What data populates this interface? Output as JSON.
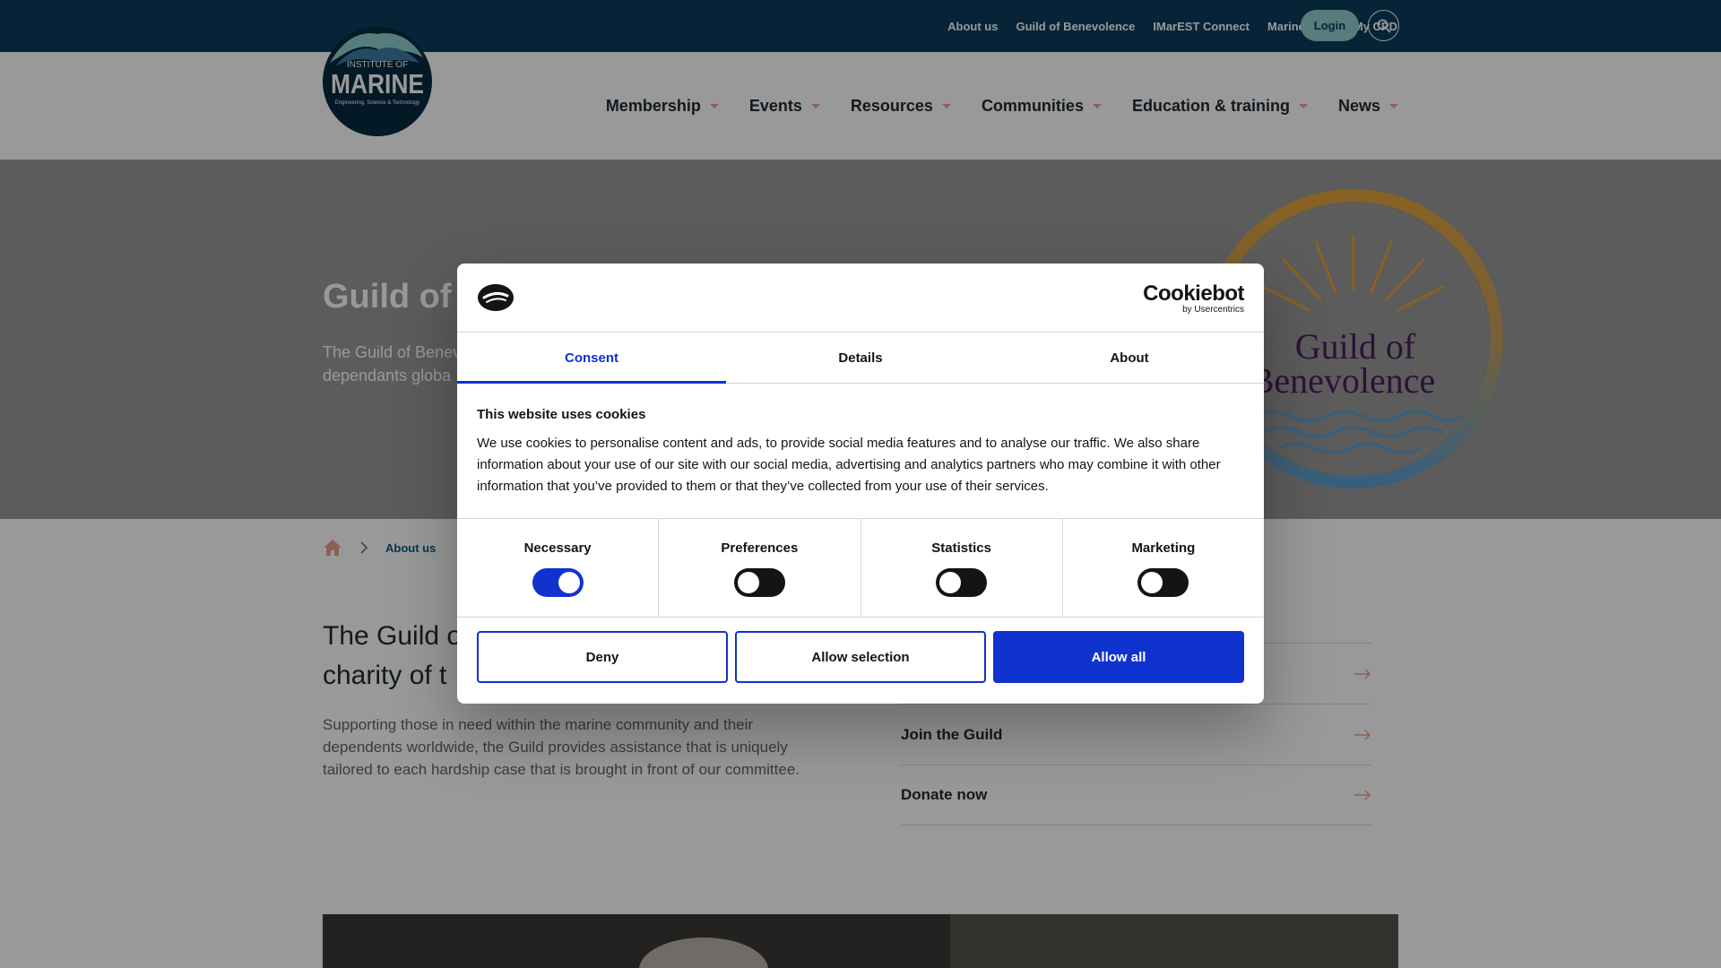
{
  "topbar": {
    "links": [
      "About us",
      "Guild of Benevolence",
      "IMarEST Connect",
      "Marine Jobs",
      "My CPD"
    ],
    "login_label": "Login",
    "search_icon": "search-icon"
  },
  "logo": {
    "line1": "INSTITUTE OF",
    "line2": "MARINE",
    "line3": "Engineering, Science & Technology"
  },
  "nav": {
    "items": [
      "Membership",
      "Events",
      "Resources",
      "Communities",
      "Education & training",
      "News"
    ]
  },
  "hero": {
    "title": "Guild of I",
    "desc_line1": "The Guild of Benev",
    "desc_line2": "dependants globa",
    "emblem_line1": "Guild of",
    "emblem_line2": "Benevolence"
  },
  "breadcrumb": {
    "home_icon": "home-icon",
    "current": "About us"
  },
  "intro": {
    "title_line1": "The Guild o",
    "title_line2": "charity of t",
    "text": "Supporting those in need within the marine community and their dependents worldwide, the Guild provides assistance that is uniquely tailored to each hardship case that is brought in front of our committee."
  },
  "side_links": [
    "Join the Guild",
    "Donate now"
  ],
  "cookie_dialog": {
    "brand": "Cookiebot",
    "brand_sub": "by Usercentrics",
    "tabs": [
      "Consent",
      "Details",
      "About"
    ],
    "active_tab": "Consent",
    "heading": "This website uses cookies",
    "body": "We use cookies to personalise content and ads, to provide social media features and to analyse our traffic. We also share information about your use of our site with our social media, advertising and analytics partners who may combine it with other information that you’ve provided to them or that they’ve collected from your use of their services.",
    "toggles": [
      {
        "label": "Necessary",
        "on": true
      },
      {
        "label": "Preferences",
        "on": false
      },
      {
        "label": "Statistics",
        "on": false
      },
      {
        "label": "Marketing",
        "on": false
      }
    ],
    "buttons": {
      "deny": "Deny",
      "allow_selection": "Allow selection",
      "allow_all": "Allow all"
    }
  },
  "colors": {
    "topbar": "#0a3b5c",
    "accent_teal": "#8fd0cf",
    "cookiebot_blue": "#1032cf",
    "nav_caret": "#e8a08e"
  }
}
